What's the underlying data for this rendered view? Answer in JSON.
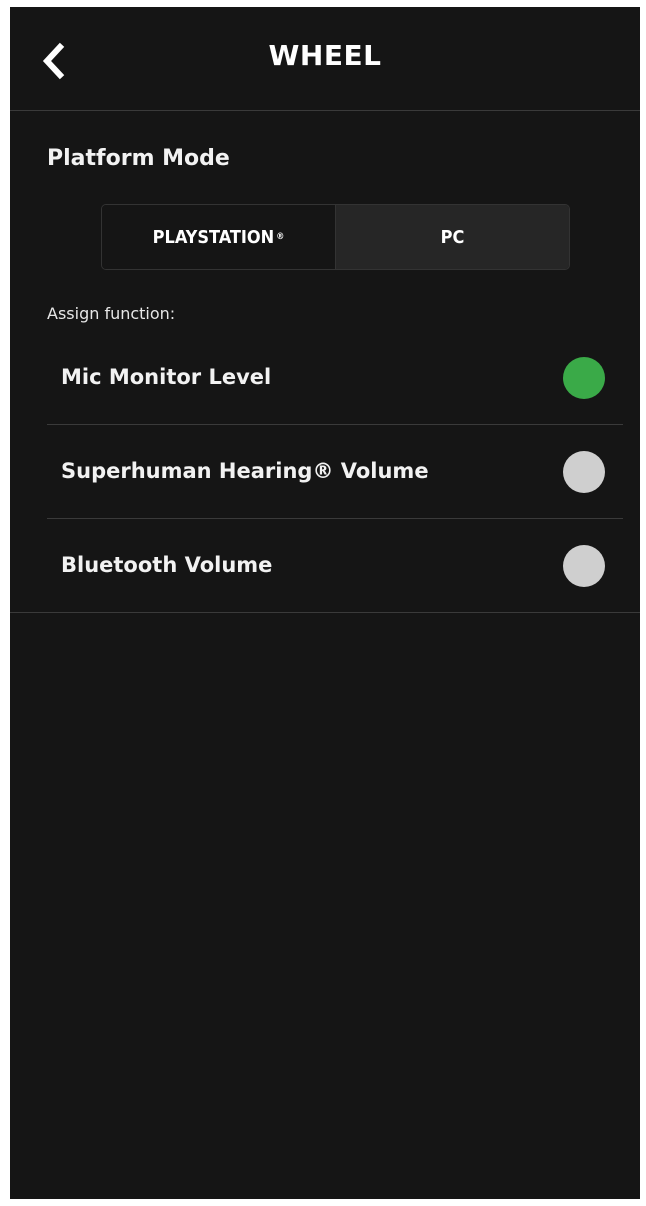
{
  "header": {
    "title": "WHEEL",
    "back_icon": "chevron-left-icon"
  },
  "platform_mode": {
    "title": "Platform Mode",
    "options": [
      {
        "label": "PLAYSTATION",
        "mark": "®",
        "selected": true
      },
      {
        "label": "PC",
        "mark": "",
        "selected": false
      }
    ]
  },
  "assign": {
    "label": "Assign function:",
    "options": [
      {
        "label": "Mic Monitor Level",
        "selected": true
      },
      {
        "label": "Superhuman Hearing® Volume",
        "selected": false
      },
      {
        "label": "Bluetooth Volume",
        "selected": false
      }
    ]
  },
  "colors": {
    "background": "#151515",
    "selected_radio": "#3aaa48",
    "unselected_radio": "#cfcfcf",
    "divider": "#3a3a3a"
  }
}
